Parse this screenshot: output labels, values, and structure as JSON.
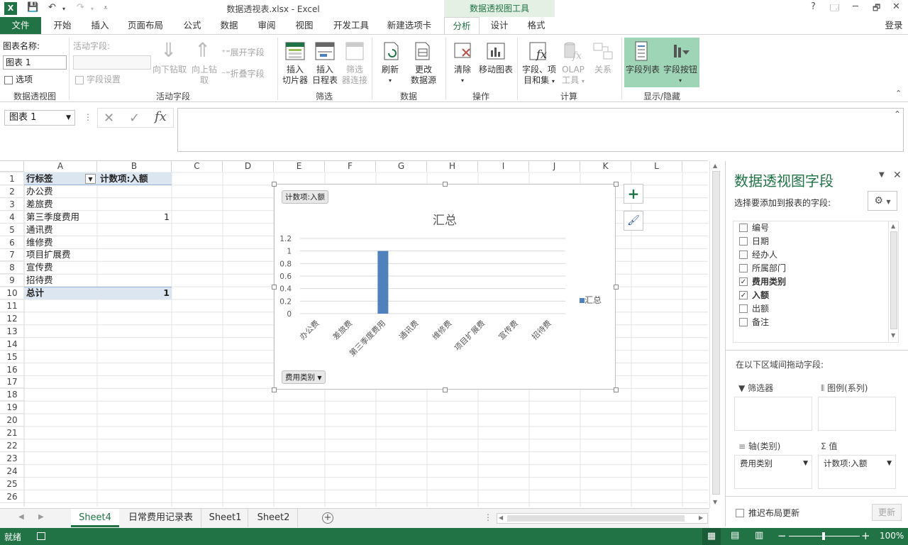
{
  "window": {
    "title": "数据透视表.xlsx - Excel",
    "context_tool": "数据透视图工具",
    "signin": "登录",
    "help": "?",
    "minimize": "─",
    "restore": "🗗",
    "close": "✕",
    "ribbon_display": "🗔"
  },
  "tabs": [
    "文件",
    "开始",
    "插入",
    "页面布局",
    "公式",
    "数据",
    "审阅",
    "视图",
    "开发工具",
    "新建选项卡",
    "分析",
    "设计",
    "格式"
  ],
  "active_tab": "分析",
  "ribbon": {
    "chart_name_label": "图表名称:",
    "chart_name_value": "图表 1",
    "options_label": "选项",
    "group_pivotchart": "数据透视图",
    "active_field_label": "活动字段:",
    "field_settings": "字段设置",
    "drill_down": "向下钻取",
    "drill_up_1": "向上钻",
    "drill_up_2": "取",
    "expand_field": "展开字段",
    "collapse_field": "折叠字段",
    "group_active_field": "活动字段",
    "insert_slicer_1": "插入",
    "insert_slicer_2": "切片器",
    "insert_timeline_1": "插入",
    "insert_timeline_2": "日程表",
    "filter_conn_1": "筛选",
    "filter_conn_2": "器连接",
    "group_filter": "筛选",
    "refresh": "刷新",
    "change_source_1": "更改",
    "change_source_2": "数据源",
    "group_data": "数据",
    "clear": "清除",
    "move_chart": "移动图表",
    "group_actions": "操作",
    "fields_items_1": "字段、项",
    "fields_items_2": "目和集",
    "olap_1": "OLAP",
    "olap_2": "工具",
    "relationships": "关系",
    "group_calc": "计算",
    "field_list": "字段列表",
    "field_buttons": "字段按钮",
    "group_showhide": "显示/隐藏"
  },
  "formula_bar": {
    "name_box": "图表 1",
    "cancel": "✕",
    "enter": "✓",
    "fx": "fx",
    "formula": ""
  },
  "grid": {
    "columns": [
      "A",
      "B",
      "C",
      "D",
      "E",
      "F",
      "G",
      "H",
      "I",
      "J",
      "K",
      "L"
    ],
    "rows": [
      "1",
      "2",
      "3",
      "4",
      "5",
      "6",
      "7",
      "8",
      "9",
      "10",
      "11",
      "12",
      "13",
      "14",
      "15",
      "16",
      "17",
      "18",
      "19",
      "20",
      "21",
      "22",
      "23",
      "24",
      "25",
      "26"
    ],
    "cells": {
      "A1": "行标签",
      "B1": "计数项:入额",
      "A2": "办公费",
      "A3": "差旅费",
      "A4": "第三季度费用",
      "B4": "1",
      "A5": "通讯费",
      "A6": "维修费",
      "A7": "项目扩展费",
      "A8": "宣传费",
      "A9": "招待费",
      "A10": "总计",
      "B10": "1"
    }
  },
  "chart_data": {
    "type": "bar",
    "title": "汇总",
    "value_field_button": "计数项:入额",
    "axis_field_button": "费用类别",
    "categories": [
      "办公费",
      "差旅费",
      "第三季度费用",
      "通讯费",
      "维修费",
      "项目扩展费",
      "宣传费",
      "招待费"
    ],
    "series": [
      {
        "name": "汇总",
        "values": [
          0,
          0,
          1,
          0,
          0,
          0,
          0,
          0
        ]
      }
    ],
    "yticks": [
      "0",
      "0.2",
      "0.4",
      "0.6",
      "0.8",
      "1",
      "1.2"
    ],
    "ylim": [
      0,
      1.2
    ],
    "grid": true,
    "legend": "right",
    "bar_color": "#4f81bd"
  },
  "pane": {
    "title": "数据透视图字段",
    "subtitle": "选择要添加到报表的字段:",
    "fields": [
      {
        "label": "编号",
        "checked": false
      },
      {
        "label": "日期",
        "checked": false
      },
      {
        "label": "经办人",
        "checked": false
      },
      {
        "label": "所属部门",
        "checked": false
      },
      {
        "label": "费用类别",
        "checked": true
      },
      {
        "label": "入额",
        "checked": true
      },
      {
        "label": "出额",
        "checked": false
      },
      {
        "label": "备注",
        "checked": false
      }
    ],
    "drag_hint": "在以下区域间拖动字段:",
    "zone_filter": "筛选器",
    "zone_legend": "图例(系列)",
    "zone_axis": "轴(类别)",
    "zone_values": "值",
    "axis_item": "费用类别",
    "values_item": "计数项:入额",
    "defer_update": "推迟布局更新",
    "update": "更新"
  },
  "sheets": [
    "Sheet4",
    "日常费用记录表",
    "Sheet1",
    "Sheet2"
  ],
  "active_sheet": "Sheet4",
  "status": {
    "ready": "就绪",
    "zoom": "100%",
    "minus": "−",
    "plus": "+"
  }
}
